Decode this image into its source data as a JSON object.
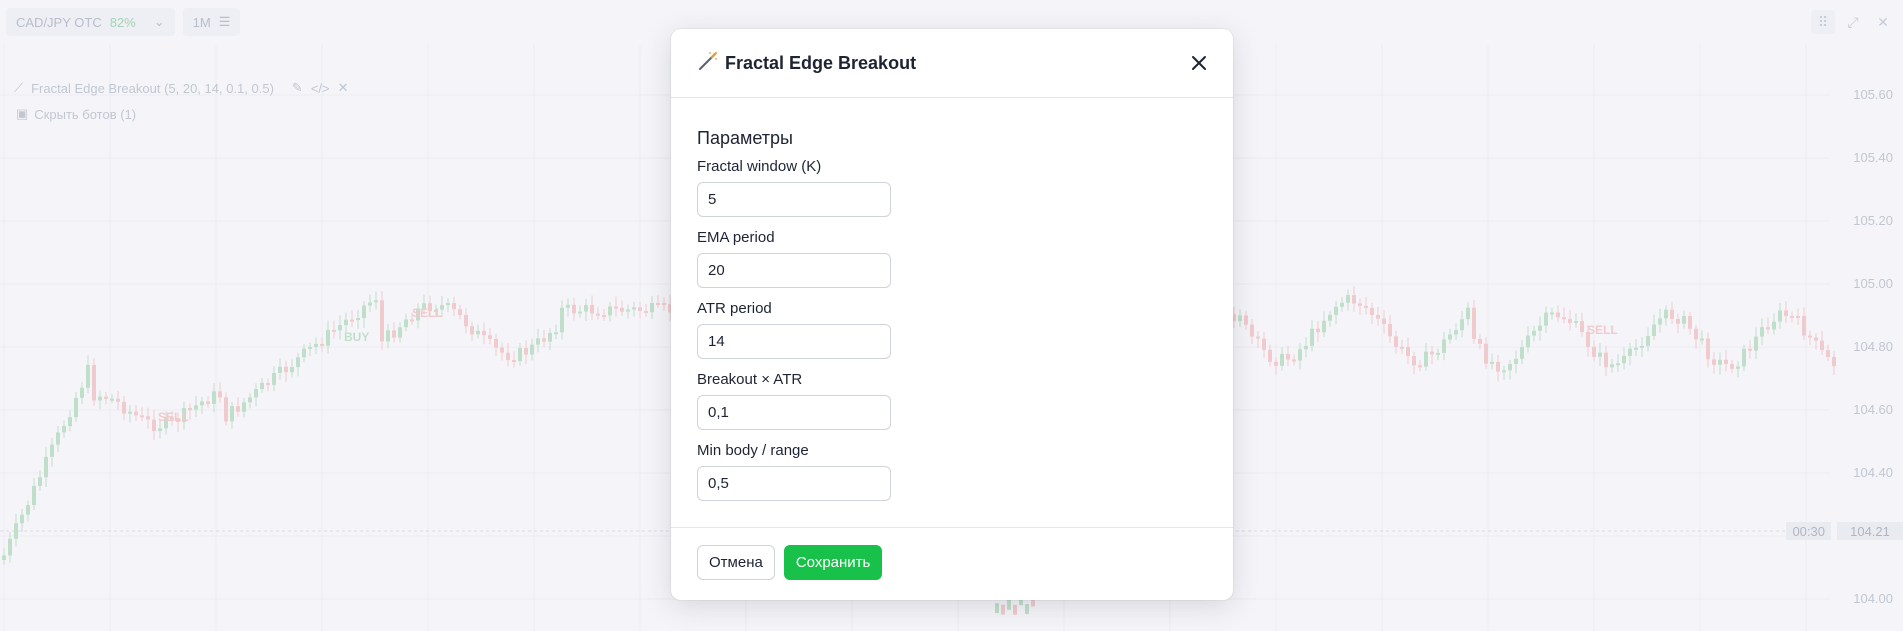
{
  "toolbar": {
    "pair": "CAD/JPY OTC",
    "payout": "82%",
    "timeframe": "1M"
  },
  "chart": {
    "indicator_label": "Fractal Edge Breakout (5, 20, 14, 0.1, 0.5)",
    "hide_bots_label": "Скрыть ботов (1)",
    "price_ticks": [
      "105.60",
      "105.40",
      "105.20",
      "105.00",
      "104.80",
      "104.60",
      "104.40",
      "104.00"
    ],
    "current_price": "104.21",
    "time_left": "00:30",
    "signals": [
      {
        "label": "SELL",
        "kind": "sell"
      },
      {
        "label": "BUY",
        "kind": "buy"
      },
      {
        "label": "SELL",
        "kind": "sell"
      },
      {
        "label": "SELL",
        "kind": "sell"
      }
    ],
    "colors": {
      "up": "#a6d6b3",
      "down": "#f2b6b9",
      "grid": "#e6e9ef"
    }
  },
  "modal": {
    "title": "Fractal Edge Breakout",
    "icon": "wand-icon",
    "section_title": "Параметры",
    "fields": [
      {
        "label": "Fractal window (K)",
        "value": "5"
      },
      {
        "label": "EMA period",
        "value": "20"
      },
      {
        "label": "ATR period",
        "value": "14"
      },
      {
        "label": "Breakout × ATR",
        "value": "0,1"
      },
      {
        "label": "Min body / range",
        "value": "0,5"
      }
    ],
    "cancel_label": "Отмена",
    "save_label": "Сохранить",
    "save_color": "#17c14a"
  }
}
